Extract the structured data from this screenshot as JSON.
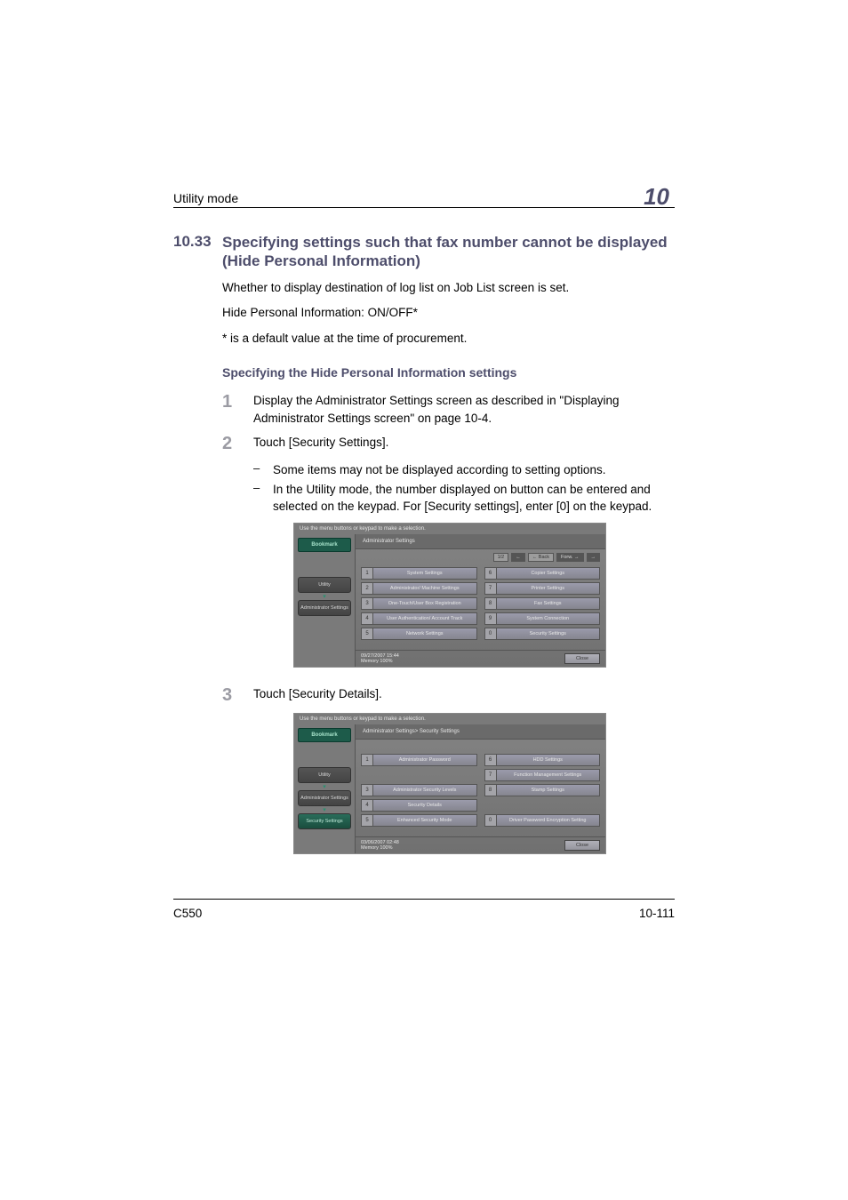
{
  "header": {
    "title": "Utility mode",
    "chapter": "10"
  },
  "section": {
    "number": "10.33",
    "title": "Specifying settings such that fax number cannot be displayed (Hide Personal Information)"
  },
  "paragraphs": {
    "p1": "Whether to display destination of log list on Job List screen is set.",
    "p2": "Hide Personal Information: ON/OFF*",
    "p3": "* is a default value at the time of procurement."
  },
  "subheading": "Specifying the Hide Personal Information settings",
  "steps": {
    "s1": {
      "num": "1",
      "text": "Display the Administrator Settings screen as described in \"Displaying Administrator Settings screen\" on page 10-4."
    },
    "s2": {
      "num": "2",
      "text": "Touch [Security Settings].",
      "bullets": [
        "Some items may not be displayed according to setting options.",
        "In the Utility mode, the number displayed on button can be entered and selected on the keypad. For [Security settings], enter [0] on the keypad."
      ]
    },
    "s3": {
      "num": "3",
      "text": "Touch [Security Details]."
    }
  },
  "screen1": {
    "instruct": "Use the menu buttons or keypad to make a selection.",
    "bookmark": "Bookmark",
    "sidebar": [
      "Utility",
      "Administrator Settings"
    ],
    "breadcrumb": "Administrator Settings",
    "pager": {
      "page": "1/2",
      "back": "← Back",
      "forw": "Forw. →"
    },
    "menu": [
      {
        "n": "1",
        "label": "System Settings",
        "n2": "6",
        "label2": "Copier Settings"
      },
      {
        "n": "2",
        "label": "Administrator/ Machine Settings",
        "n2": "7",
        "label2": "Printer Settings"
      },
      {
        "n": "3",
        "label": "One-Touch/User Box Registration",
        "n2": "8",
        "label2": "Fax Settings"
      },
      {
        "n": "4",
        "label": "User Authentication/ Account Track",
        "n2": "9",
        "label2": "System Connection"
      },
      {
        "n": "5",
        "label": "Network Settings",
        "n2": "0",
        "label2": "Security Settings"
      }
    ],
    "footer": {
      "date": "09/27/2007   15:44",
      "mem": "Memory        100%",
      "close": "Close"
    }
  },
  "screen2": {
    "instruct": "Use the menu buttons or keypad to make a selection.",
    "bookmark": "Bookmark",
    "sidebar": [
      "Utility",
      "Administrator Settings",
      "Security Settings"
    ],
    "breadcrumb": "Administrator Settings> Security Settings",
    "menu": [
      {
        "n": "1",
        "label": "Administrator Password",
        "n2": "6",
        "label2": "HDD Settings"
      },
      {
        "n": "",
        "label": "",
        "n2": "7",
        "label2": "Function Management Settings"
      },
      {
        "n": "3",
        "label": "Administrator Security Levels",
        "n2": "8",
        "label2": "Stamp Settings"
      },
      {
        "n": "4",
        "label": "Security Details",
        "n2": "",
        "label2": ""
      },
      {
        "n": "5",
        "label": "Enhanced Security Mode",
        "n2": "0",
        "label2": "Driver Password Encryption Setting"
      }
    ],
    "footer": {
      "date": "03/06/2007   02:48",
      "mem": "Memory        100%",
      "close": "Close"
    }
  },
  "footer": {
    "model": "C550",
    "pagenum": "10-111"
  }
}
